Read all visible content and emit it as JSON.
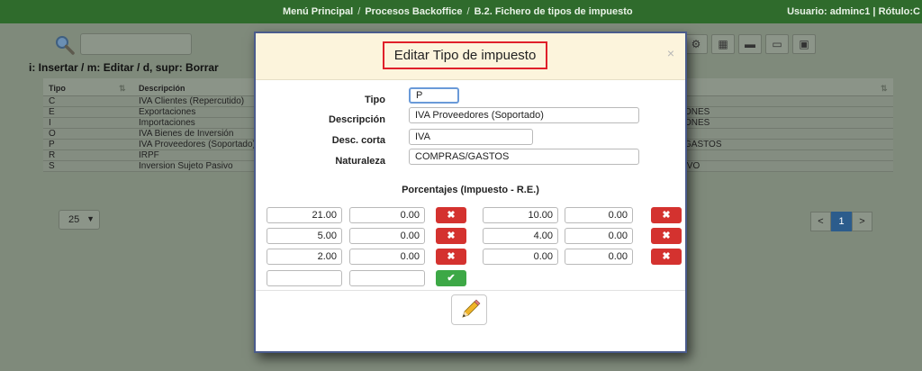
{
  "topbar": {
    "crumbs": [
      "Menú Principal",
      "Procesos Backoffice",
      "B.2. Fichero de tipos de impuesto"
    ],
    "separator": "/",
    "user": "Usuario: adminc1 | Rótulo:C"
  },
  "background": {
    "help": "i: Insertar / m: Editar / d, supr: Borrar",
    "headers": {
      "tipo": "Tipo",
      "descripcion": "Descripción",
      "sort": "⇅"
    },
    "rows": [
      {
        "tipo": "C",
        "descripcion": "IVA Clientes (Repercutido)",
        "naturaleza": ""
      },
      {
        "tipo": "E",
        "descripcion": "Exportaciones",
        "naturaleza": "ONES"
      },
      {
        "tipo": "I",
        "descripcion": "Importaciones",
        "naturaleza": "ONES"
      },
      {
        "tipo": "O",
        "descripcion": "IVA Bienes de Inversión",
        "naturaleza": ""
      },
      {
        "tipo": "P",
        "descripcion": "IVA Proveedores (Soportado)",
        "naturaleza": "GASTOS"
      },
      {
        "tipo": "R",
        "descripcion": "IRPF",
        "naturaleza": ""
      },
      {
        "tipo": "S",
        "descripcion": "Inversion Sujeto Pasivo",
        "naturaleza": "IVO"
      }
    ],
    "page_size": "25",
    "pager": {
      "prev": "<",
      "page": "1",
      "next": ">"
    }
  },
  "modal": {
    "title": "Editar Tipo de impuesto",
    "close": "×",
    "labels": {
      "tipo": "Tipo",
      "descripcion": "Descripción",
      "desc_corta": "Desc. corta",
      "naturaleza": "Naturaleza"
    },
    "values": {
      "tipo": "P",
      "descripcion": "IVA Proveedores (Soportado)",
      "desc_corta": "IVA",
      "naturaleza": "COMPRAS/GASTOS"
    },
    "section_title": "Porcentajes (Impuesto - R.E.)",
    "percentages": [
      {
        "impuesto": "21.00",
        "re": "0.00"
      },
      {
        "impuesto": "10.00",
        "re": "0.00"
      },
      {
        "impuesto": "5.00",
        "re": "0.00"
      },
      {
        "impuesto": "4.00",
        "re": "0.00"
      },
      {
        "impuesto": "2.00",
        "re": "0.00"
      },
      {
        "impuesto": "0.00",
        "re": "0.00"
      }
    ],
    "delete_symbol": "✖",
    "add_symbol": "✔",
    "colors": {
      "delete": "#d4322f",
      "add": "#3da846",
      "header": "#fcf4dc",
      "title_border": "#e0202a"
    }
  }
}
